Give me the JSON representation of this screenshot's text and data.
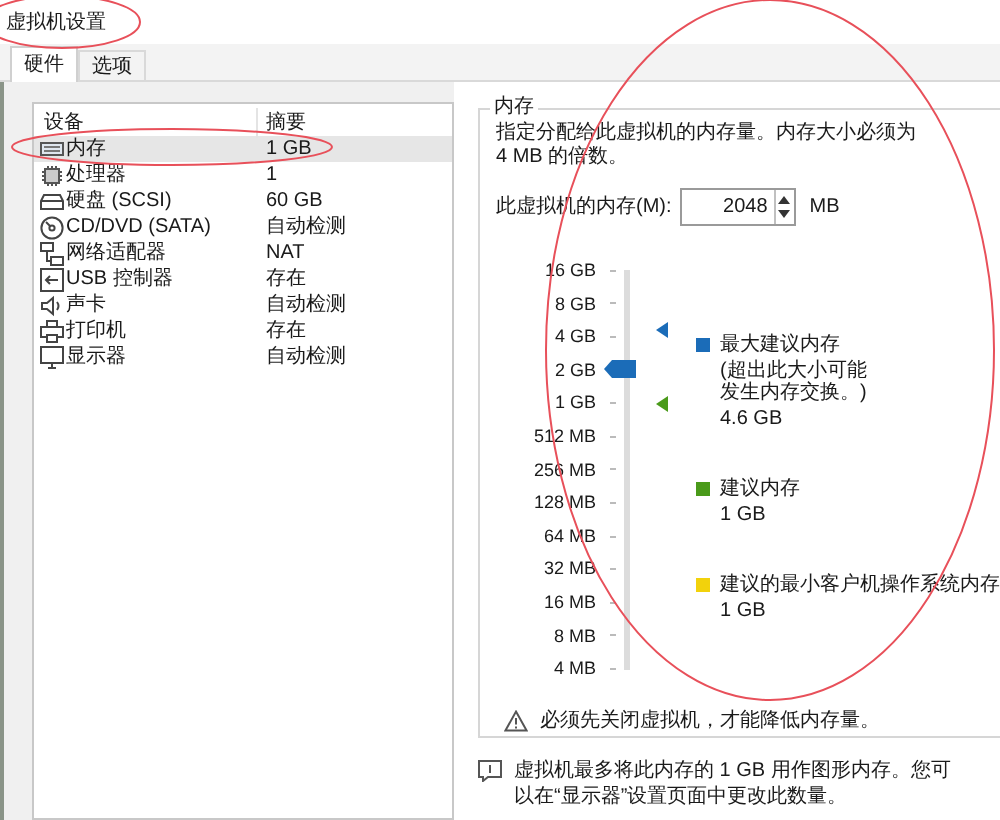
{
  "window": {
    "title": "虚拟机设置"
  },
  "tabs": [
    {
      "label": "硬件",
      "selected": true
    },
    {
      "label": "选项",
      "selected": false
    }
  ],
  "devices": {
    "columns": [
      "设备",
      "摘要"
    ],
    "rows": [
      {
        "device": "内存",
        "summary": "1 GB",
        "selected": true
      },
      {
        "device": "处理器",
        "summary": "1",
        "selected": false
      },
      {
        "device": "硬盘 (SCSI)",
        "summary": "60 GB",
        "selected": false
      },
      {
        "device": "CD/DVD (SATA)",
        "summary": "自动检测",
        "selected": false
      },
      {
        "device": "网络适配器",
        "summary": "NAT",
        "selected": false
      },
      {
        "device": "USB 控制器",
        "summary": "存在",
        "selected": false
      },
      {
        "device": "声卡",
        "summary": "自动检测",
        "selected": false
      },
      {
        "device": "打印机",
        "summary": "存在",
        "selected": false
      },
      {
        "device": "显示器",
        "summary": "自动检测",
        "selected": false
      }
    ]
  },
  "memory": {
    "title": "内存",
    "description": "指定分配给此虚拟机的内存量。内存大小必须为 4 MB 的倍数。",
    "field_label": "此虚拟机的内存(M):",
    "value": "2048",
    "unit": "MB",
    "slider": {
      "ticks": [
        "16 GB",
        "8 GB",
        "4 GB",
        "2 GB",
        "1 GB",
        "512 MB",
        "256 MB",
        "128 MB",
        "64 MB",
        "32 MB",
        "16 MB",
        "8 MB",
        "4 MB"
      ],
      "level": 0.75,
      "markers": [
        {
          "level": 0.85,
          "color": "#1b6cb8"
        },
        {
          "level": 0.6667,
          "color": "#4a9a1a"
        }
      ]
    },
    "legend": [
      {
        "label": "最大建议内存",
        "note": "(超出此大小可能发生内存交换。)",
        "value": "4.6 GB",
        "color": "#1b6cb8"
      },
      {
        "label": "建议内存",
        "value": "1 GB",
        "color": "#4a9a1a"
      },
      {
        "label": "建议的最小客户机操作系统内存",
        "value": "1 GB",
        "color": "#f2d20c"
      }
    ],
    "warning": "必须先关闭虚拟机，才能降低内存量。"
  },
  "note": "虚拟机最多将此内存的 1 GB 用作图形内存。您可以在“显示器”设置页面中更改此数量。"
}
